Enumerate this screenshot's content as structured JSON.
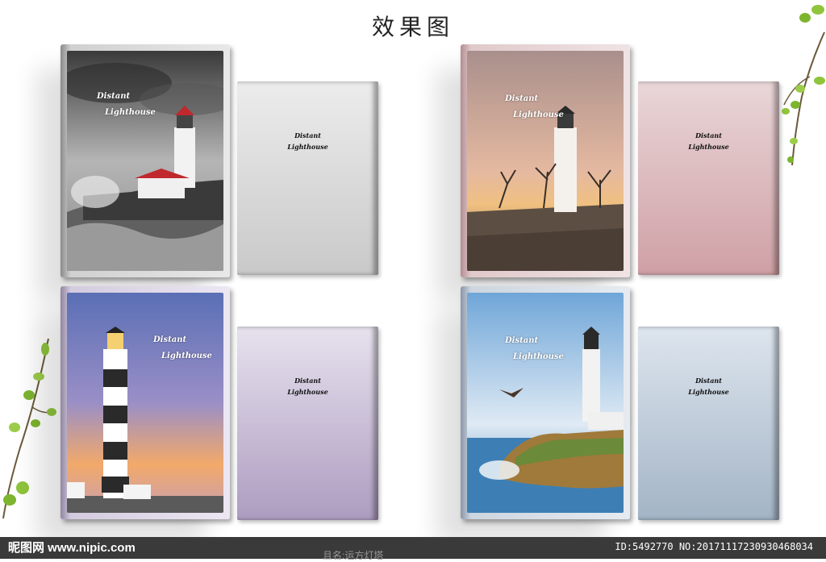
{
  "title": "效果图",
  "cover_text": {
    "line1": "Distant",
    "line2": "Lighthouse"
  },
  "books": [
    {
      "name": "book-grey",
      "theme": "grayscale",
      "back_color": "#d8d8d8"
    },
    {
      "name": "book-pink",
      "theme": "sunset-pink",
      "back_color": "#d4a9ad"
    },
    {
      "name": "book-purple",
      "theme": "striped-purple",
      "back_color": "#b7a8c8"
    },
    {
      "name": "book-blue",
      "theme": "sea-blue",
      "back_color": "#a9b8c9"
    }
  ],
  "footer": {
    "logo": "昵图网 www.nipic.com",
    "id_text": "ID:5492770 NO:20171117230930468034",
    "under_text": "且名:运方灯塔"
  }
}
